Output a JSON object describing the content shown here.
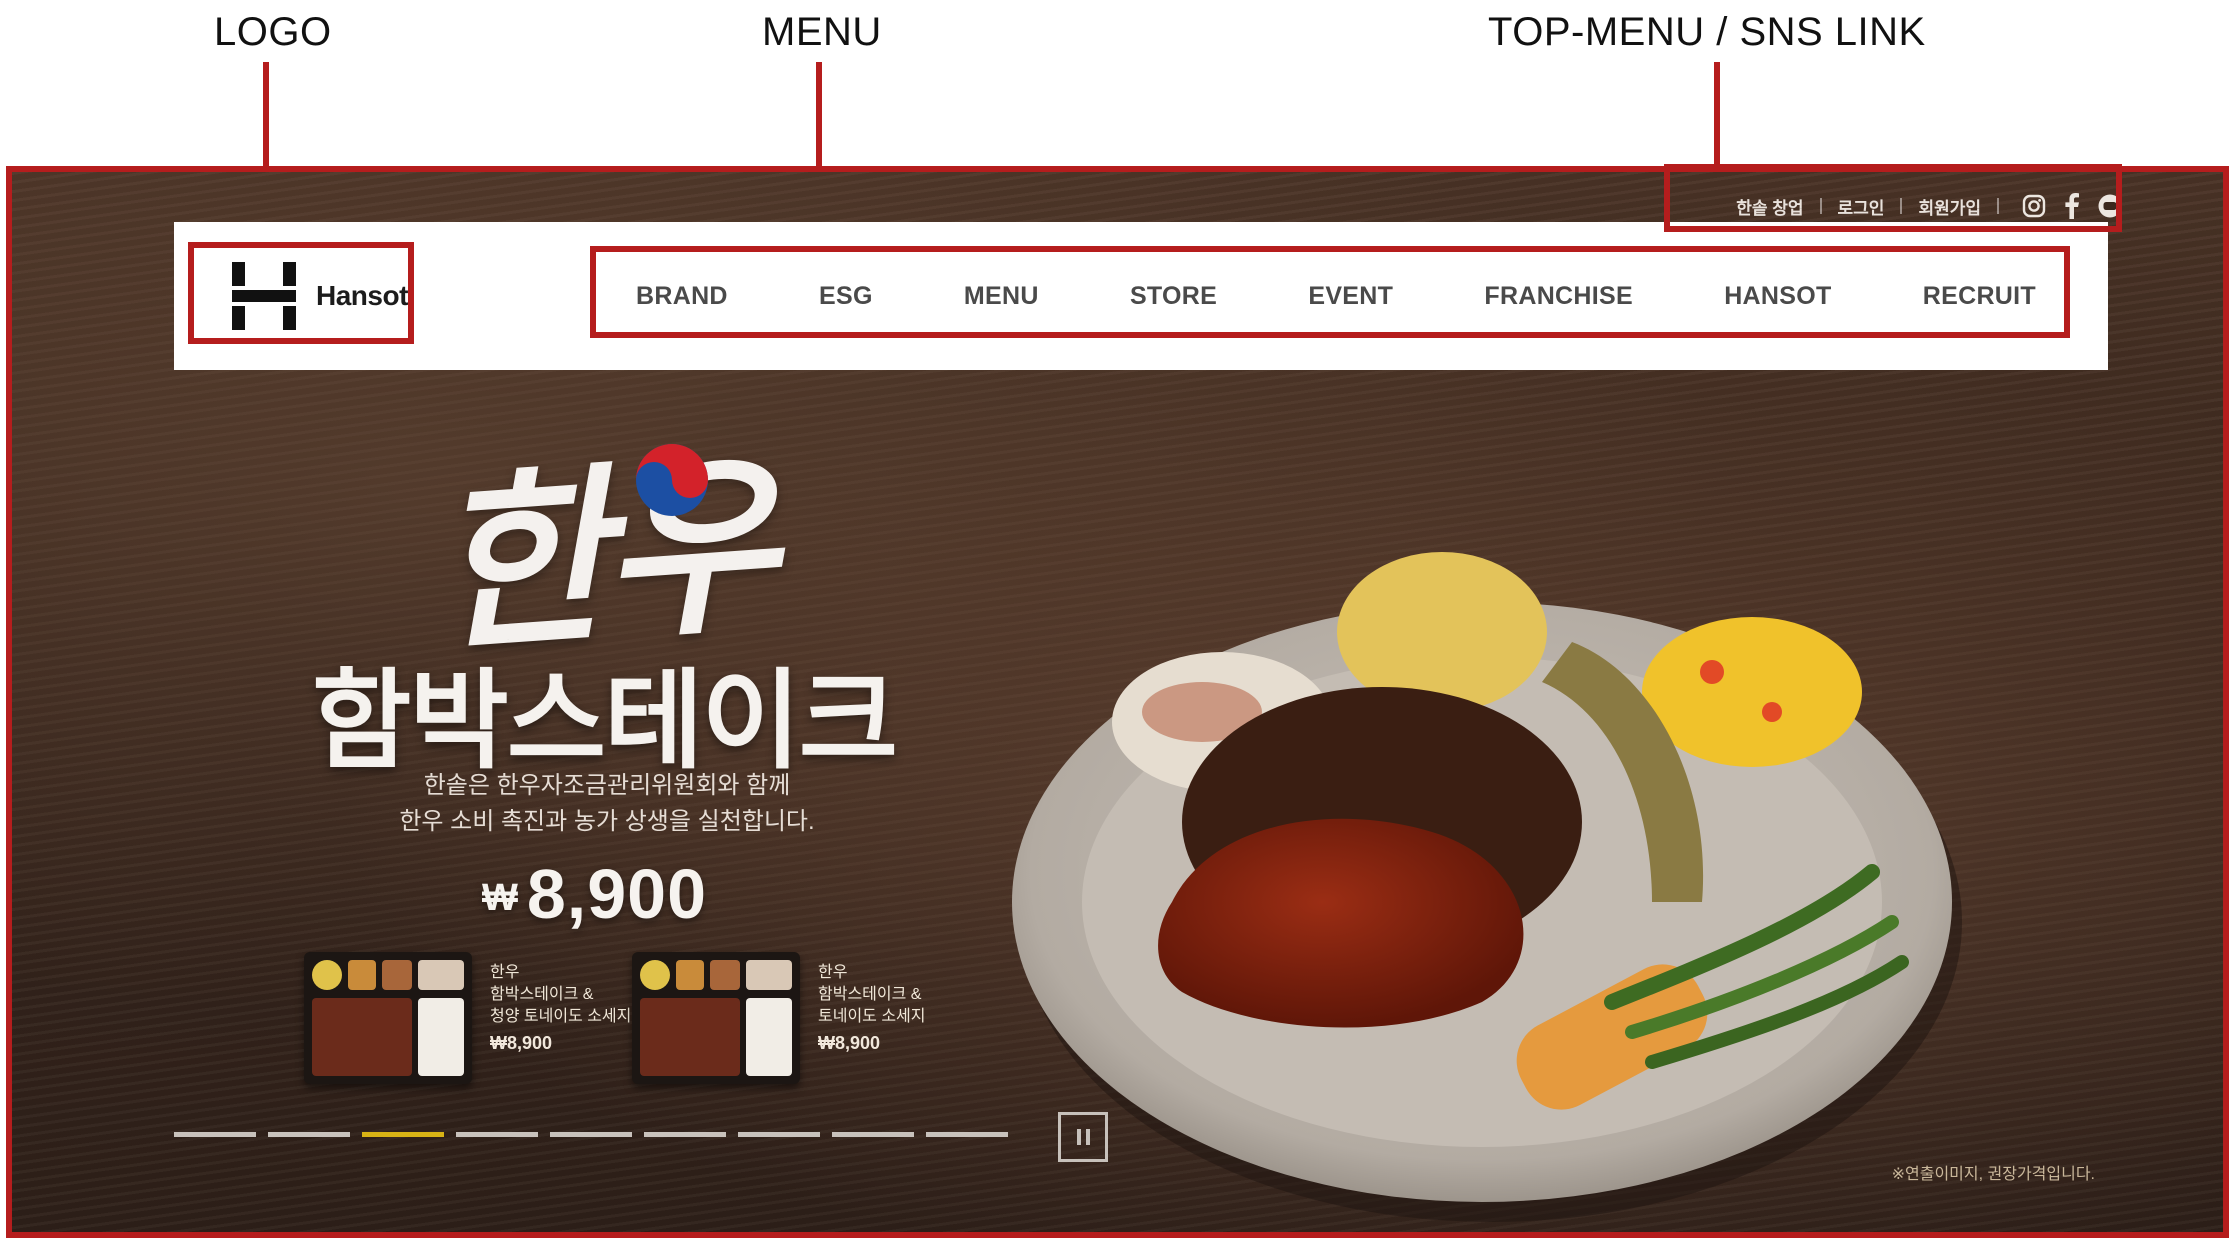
{
  "annotations": {
    "logo": "LOGO",
    "menu": "MENU",
    "top_menu": "TOP-MENU / SNS LINK"
  },
  "top_menu": {
    "items": [
      "한솥 창업",
      "로그인",
      "회원가입"
    ],
    "sns": [
      "instagram-icon",
      "facebook-icon",
      "youtube-icon"
    ]
  },
  "logo": {
    "text": "Hansot"
  },
  "menu": {
    "items": [
      "BRAND",
      "ESG",
      "MENU",
      "STORE",
      "EVENT",
      "FRANCHISE",
      "HANSOT",
      "RECRUIT"
    ]
  },
  "hero": {
    "script_title": "한우",
    "title": "함박스테이크",
    "desc_line1": "한솥은 한우자조금관리위원회와 함께",
    "desc_line2": "한우 소비 촉진과 농가 상생을 실천합니다.",
    "price_symbol": "₩",
    "price": "8,900",
    "disclaimer": "※연출이미지, 권장가격입니다.",
    "products": [
      {
        "line1": "한우",
        "line2": "함박스테이크 &",
        "line3": "청양 토네이도 소세지",
        "price": "₩8,900"
      },
      {
        "line1": "한우",
        "line2": "함박스테이크 &",
        "line3": "토네이도 소세지",
        "price": "₩8,900"
      }
    ]
  },
  "slider": {
    "count": 9,
    "active_index": 2
  },
  "colors": {
    "annotation": "#b51d1d",
    "active_indicator": "#d8b315"
  }
}
